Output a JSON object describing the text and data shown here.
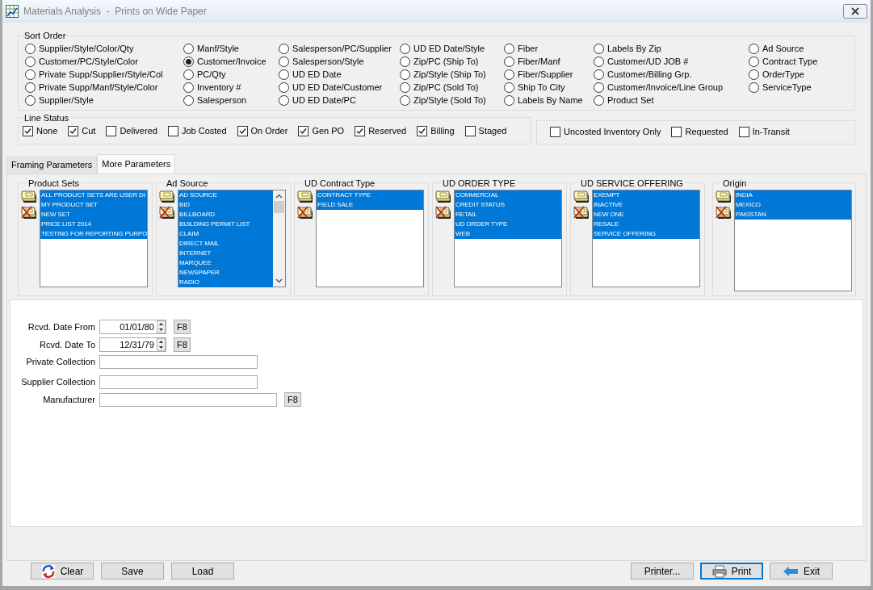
{
  "window": {
    "title": "Materials Analysis  -  Prints on Wide Paper"
  },
  "sort_order": {
    "label": "Sort Order",
    "columns": [
      [
        {
          "label": "Supplier/Style/Color/Qty",
          "selected": false
        },
        {
          "label": "Customer/PC/Style/Color",
          "selected": false
        },
        {
          "label": "Private Supp/Supplier/Style/Col",
          "selected": false
        },
        {
          "label": "Private Supp/Manf/Style/Color",
          "selected": false
        },
        {
          "label": "Supplier/Style",
          "selected": false
        }
      ],
      [
        {
          "label": "Manf/Style",
          "selected": false
        },
        {
          "label": "Customer/Invoice",
          "selected": true
        },
        {
          "label": "PC/Qty",
          "selected": false
        },
        {
          "label": "Inventory #",
          "selected": false
        },
        {
          "label": "Salesperson",
          "selected": false
        }
      ],
      [
        {
          "label": "Salesperson/PC/Supplier",
          "selected": false
        },
        {
          "label": "Salesperson/Style",
          "selected": false
        },
        {
          "label": "UD ED Date",
          "selected": false
        },
        {
          "label": "UD ED Date/Customer",
          "selected": false
        },
        {
          "label": "UD ED Date/PC",
          "selected": false
        }
      ],
      [
        {
          "label": "UD ED Date/Style",
          "selected": false
        },
        {
          "label": "Zip/PC (Ship To)",
          "selected": false
        },
        {
          "label": "Zip/Style (Ship To)",
          "selected": false
        },
        {
          "label": "Zip/PC (Sold To)",
          "selected": false
        },
        {
          "label": "Zip/Style (Sold To)",
          "selected": false
        }
      ],
      [
        {
          "label": "Fiber",
          "selected": false
        },
        {
          "label": "Fiber/Manf",
          "selected": false
        },
        {
          "label": "Fiber/Supplier",
          "selected": false
        },
        {
          "label": "Ship To City",
          "selected": false
        },
        {
          "label": "Labels By Name",
          "selected": false
        }
      ],
      [
        {
          "label": "Labels By Zip",
          "selected": false
        },
        {
          "label": "Customer/UD JOB #",
          "selected": false
        },
        {
          "label": "Customer/Billing Grp.",
          "selected": false
        },
        {
          "label": "Customer/Invoice/Line Group",
          "selected": false
        },
        {
          "label": "Product Set",
          "selected": false
        }
      ],
      [
        {
          "label": "Ad Source",
          "selected": false
        },
        {
          "label": "Contract Type",
          "selected": false
        },
        {
          "label": "OrderType",
          "selected": false
        },
        {
          "label": "ServiceType",
          "selected": false
        }
      ]
    ]
  },
  "line_status": {
    "label": "Line Status",
    "items": [
      {
        "label": "None",
        "checked": true
      },
      {
        "label": "Cut",
        "checked": true
      },
      {
        "label": "Delivered",
        "checked": false
      },
      {
        "label": "Job Costed",
        "checked": false
      },
      {
        "label": "On Order",
        "checked": true
      },
      {
        "label": "Gen PO",
        "checked": true
      },
      {
        "label": "Reserved",
        "checked": true
      },
      {
        "label": "Billing",
        "checked": true
      },
      {
        "label": "Staged",
        "checked": false
      }
    ]
  },
  "other_filters": [
    {
      "label": "Uncosted Inventory Only",
      "checked": false
    },
    {
      "label": "Requested",
      "checked": false
    },
    {
      "label": "In-Transit",
      "checked": false
    }
  ],
  "tabs": [
    {
      "label": "Framing Parameters",
      "selected": false
    },
    {
      "label": "More Parameters",
      "selected": true
    }
  ],
  "lists": [
    {
      "title": "Product Sets",
      "scrollbar": false,
      "items": [
        {
          "label": "ALL PRODUCT SETS ARE USER DI",
          "selected": true
        },
        {
          "label": "MY PRODUCT SET",
          "selected": true
        },
        {
          "label": "NEW SET",
          "selected": true
        },
        {
          "label": "PRICE LIST 2014",
          "selected": true
        },
        {
          "label": "TESTING FOR REPORTING PURPO",
          "selected": true
        }
      ]
    },
    {
      "title": "Ad Source",
      "scrollbar": true,
      "items": [
        {
          "label": "AD SOURCE",
          "selected": true
        },
        {
          "label": "BID",
          "selected": true
        },
        {
          "label": "BILLBOARD",
          "selected": true
        },
        {
          "label": "BUILDING PERMIT LIST",
          "selected": true
        },
        {
          "label": "CLAIM",
          "selected": true
        },
        {
          "label": "DIRECT MAIL",
          "selected": true
        },
        {
          "label": "INTERNET",
          "selected": true
        },
        {
          "label": "MARQUEE",
          "selected": true
        },
        {
          "label": "NEWSPAPER",
          "selected": true
        },
        {
          "label": "RADIO",
          "selected": true
        }
      ]
    },
    {
      "title": "UD Contract Type",
      "scrollbar": false,
      "items": [
        {
          "label": "CONTRACT TYPE",
          "selected": true
        },
        {
          "label": "FIELD SALE",
          "selected": true
        }
      ]
    },
    {
      "title": "UD ORDER TYPE",
      "scrollbar": false,
      "items": [
        {
          "label": "COMMERCIAL",
          "selected": true
        },
        {
          "label": "CREDIT STATUS",
          "selected": true
        },
        {
          "label": "RETAIL",
          "selected": true
        },
        {
          "label": "UD ORDER TYPE",
          "selected": true
        },
        {
          "label": "WEB",
          "selected": true
        }
      ]
    },
    {
      "title": "UD SERVICE OFFERING",
      "scrollbar": false,
      "items": [
        {
          "label": "EXEMPT",
          "selected": true
        },
        {
          "label": "INACTIVE",
          "selected": true
        },
        {
          "label": "NEW ONE",
          "selected": true
        },
        {
          "label": "RESALE",
          "selected": true
        },
        {
          "label": "SERVICE OFFERING",
          "selected": true
        }
      ]
    },
    {
      "title": "Origin",
      "scrollbar": false,
      "items": [
        {
          "label": "INDIA",
          "selected": true
        },
        {
          "label": "MEXICO",
          "selected": true
        },
        {
          "label": "PAKISTAN",
          "selected": true
        }
      ]
    }
  ],
  "fields": [
    {
      "kind": "date",
      "label": "Rcvd. Date From",
      "value": "01/01/80",
      "button": "F8"
    },
    {
      "kind": "date",
      "label": "Rcvd. Date To",
      "value": "12/31/79",
      "button": "F8"
    },
    {
      "kind": "text",
      "label": "Private Collection"
    },
    {
      "kind": "text",
      "label": "Supplier Collection"
    },
    {
      "kind": "wide",
      "label": "Manufacturer",
      "button": "F8"
    }
  ],
  "buttons_left": [
    {
      "kind": "clear",
      "label": "Clear"
    },
    {
      "kind": "plain",
      "label": "Save"
    },
    {
      "kind": "plain",
      "label": "Load"
    }
  ],
  "buttons_right": [
    {
      "kind": "plain",
      "label": "Printer...",
      "default": false
    },
    {
      "kind": "print",
      "label": "Print",
      "default": true
    },
    {
      "kind": "exit",
      "label": "Exit",
      "default": false
    }
  ]
}
